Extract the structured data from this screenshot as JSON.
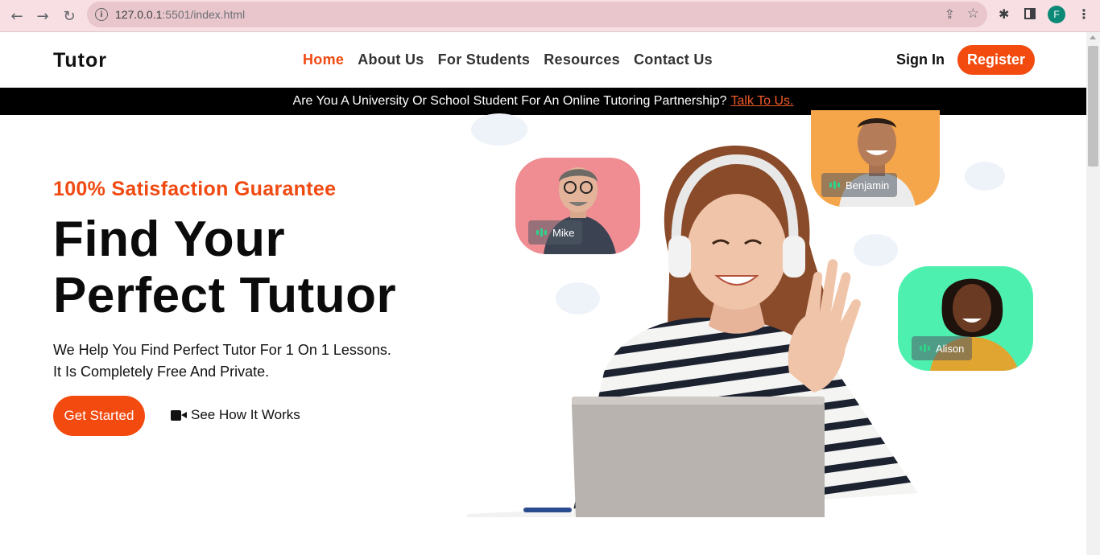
{
  "browser": {
    "url_host": "127.0.0.1",
    "url_path": ":5501/index.html",
    "profile_initial": "F"
  },
  "header": {
    "logo": "Tutor",
    "nav": [
      "Home",
      "About Us",
      "For Students",
      "Resources",
      "Contact Us"
    ],
    "active_nav": "Home",
    "sign_in": "Sign In",
    "register": "Register"
  },
  "banner": {
    "text": "Are You A University Or School Student For An Online Tutoring Partnership?",
    "link": "Talk To Us."
  },
  "hero": {
    "eyebrow": "100% Satisfaction Guarantee",
    "title_line1": "Find Your",
    "title_line2": "Perfect Tutuor",
    "sub_line1": "We Help You Find Perfect Tutor For 1 On 1 Lessons.",
    "sub_line2": "It Is Completely Free And Private.",
    "cta": "Get Started",
    "secondary": "See How It Works"
  },
  "tutors": [
    {
      "name": "Mike",
      "color": "#ef8d92"
    },
    {
      "name": "Benjamin",
      "color": "#f5a54a"
    },
    {
      "name": "Alison",
      "color": "#4ef0b0"
    }
  ],
  "colors": {
    "accent": "#f24a0f",
    "banner_bg": "#000000"
  }
}
